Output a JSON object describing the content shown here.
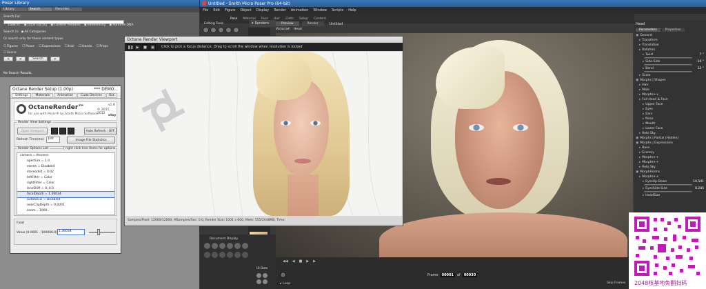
{
  "library": {
    "title": "Poser Library",
    "tabs": [
      "Library",
      "Search",
      "Favorites"
    ],
    "search_for_label": "Search For:",
    "look_in_label": "Look in:",
    "sources": [
      "Local Library",
      "Content Paradise",
      "Renderosity",
      "Runtime DNA"
    ],
    "search_in_label": "Search in:",
    "search_in_value": "All Categories",
    "content_types_label": "Or search only for these content types",
    "types": [
      "Figures",
      "Poses",
      "Expressions",
      "Hair",
      "Hands",
      "Props",
      "Scene"
    ],
    "search_btn": "Search",
    "results": "No Search Results"
  },
  "octane_setup": {
    "title": "Octane Render Setup (1.00p)",
    "title_extra": "*** DEMO...",
    "tabs": [
      "Settings",
      "Materials",
      "Animation",
      "Cuda Devices",
      "Oct"
    ],
    "logo": "OctaneRender™",
    "logo_sub": "for use with Poser® by Smith Micro Software",
    "version": "v1.0",
    "copyright": "© 2011, 2012",
    "brand": "otoy",
    "view_settings_label": "Render View Settings",
    "open_viewport": "Open Viewport",
    "auto_refresh": "Auto Refresh : OFF",
    "refresh_label": "Refresh Time(ms)",
    "refresh_value": "100",
    "image_stats": "Image File Statistics",
    "options_label": "Render Options List",
    "options_hint": "[ right click tree items for options",
    "tree": [
      "camera = thinlens",
      "aperture = 1.0",
      "stereo = Disabled",
      "stereodist = 0.02",
      "leftFilter = Color",
      "rightFilter = Color",
      "lensShift = 0, 0.0",
      "focalDepth = 1.36034",
      "autofocus = Disabled",
      "nearClipDepth = 0.0001",
      "zoom... 1000..."
    ],
    "float_label": "Float",
    "value_label": "Value (0.0001 - 100000.0)",
    "value": "1.36034"
  },
  "viewport": {
    "title": "Octane Render Viewport",
    "hint": "Click to pick a focus distance.  Drag to scroll the window when resolution is locked",
    "status": "Samples/Pixel: 12000/12000, MSamples/Sec: 0.0, Render Size: 1001 x 600, Mem: 555/2048MB, Time:"
  },
  "poser": {
    "title": "Untitled - Smith Micro Poser Pro  (64-bit)",
    "menu": [
      "File",
      "Edit",
      "Figure",
      "Object",
      "Display",
      "Render",
      "Animation",
      "Window",
      "Scripts",
      "Help"
    ],
    "rooms": [
      "Pose",
      "Material",
      "Face",
      "Hair",
      "Cloth",
      "Setup",
      "Content"
    ],
    "editing_tools": "Editing Tools",
    "renders_label": "Renders",
    "doc_tabs": [
      "Preview",
      "Render"
    ],
    "doc_title": "Untitled",
    "figure_sel": "Victoria4",
    "part_sel": "Head",
    "document_display": "Document Display",
    "ui_dots": "UI Dots",
    "frame_label": "Frame",
    "frame_value": "00001",
    "of_label": "of",
    "frame_total": "00030",
    "loop": "Loop",
    "skip_frames": "Skip Frames"
  },
  "params": {
    "title": "Head",
    "tabs": [
      "Parameters",
      "Properties"
    ],
    "items": [
      {
        "t": "General",
        "ind": 0
      },
      {
        "t": "Transform",
        "ind": 1
      },
      {
        "t": "Translation",
        "ind": 1
      },
      {
        "t": "Rotation",
        "ind": 1
      },
      {
        "t": "Twist",
        "ind": 2,
        "v": "7 °",
        "sl": true
      },
      {
        "t": "Side-Side",
        "ind": 2,
        "v": "-16 °",
        "sl": true
      },
      {
        "t": "Bend",
        "ind": 2,
        "v": "12 °",
        "sl": true
      },
      {
        "t": "Scale",
        "ind": 1
      },
      {
        "t": "Morphs | Shapes",
        "ind": 0
      },
      {
        "t": "Hair",
        "ind": 1
      },
      {
        "t": "Male",
        "ind": 1
      },
      {
        "t": "Morphs++",
        "ind": 1
      },
      {
        "t": "Full Head & Face",
        "ind": 1
      },
      {
        "t": "Upper Face",
        "ind": 2
      },
      {
        "t": "Eyes",
        "ind": 2
      },
      {
        "t": "Ears",
        "ind": 2
      },
      {
        "t": "Nose",
        "ind": 2
      },
      {
        "t": "Mouth",
        "ind": 2
      },
      {
        "t": "Lower Face",
        "ind": 2
      },
      {
        "t": "Reto Sky",
        "ind": 1
      },
      {
        "t": "Morphs | Partial (Hidden)",
        "ind": 0
      },
      {
        "t": "Morphs | Expressions",
        "ind": 0
      },
      {
        "t": "Base",
        "ind": 1
      },
      {
        "t": "Ecaresy",
        "ind": 1
      },
      {
        "t": "Morphs++",
        "ind": 1
      },
      {
        "t": "Morphs++",
        "ind": 1
      },
      {
        "t": "Reto Sky",
        "ind": 1
      },
      {
        "t": "MorphHorms",
        "ind": 0
      },
      {
        "t": "Morphs++",
        "ind": 1
      },
      {
        "t": "EyesUp-Down",
        "ind": 2,
        "v": "10.541",
        "sl": true
      },
      {
        "t": "EyesSide-Side",
        "ind": 2,
        "v": "0.245",
        "sl": true
      },
      {
        "t": "HeadSize",
        "ind": 2
      }
    ]
  },
  "watermark": "2048核基地免翻扫码"
}
